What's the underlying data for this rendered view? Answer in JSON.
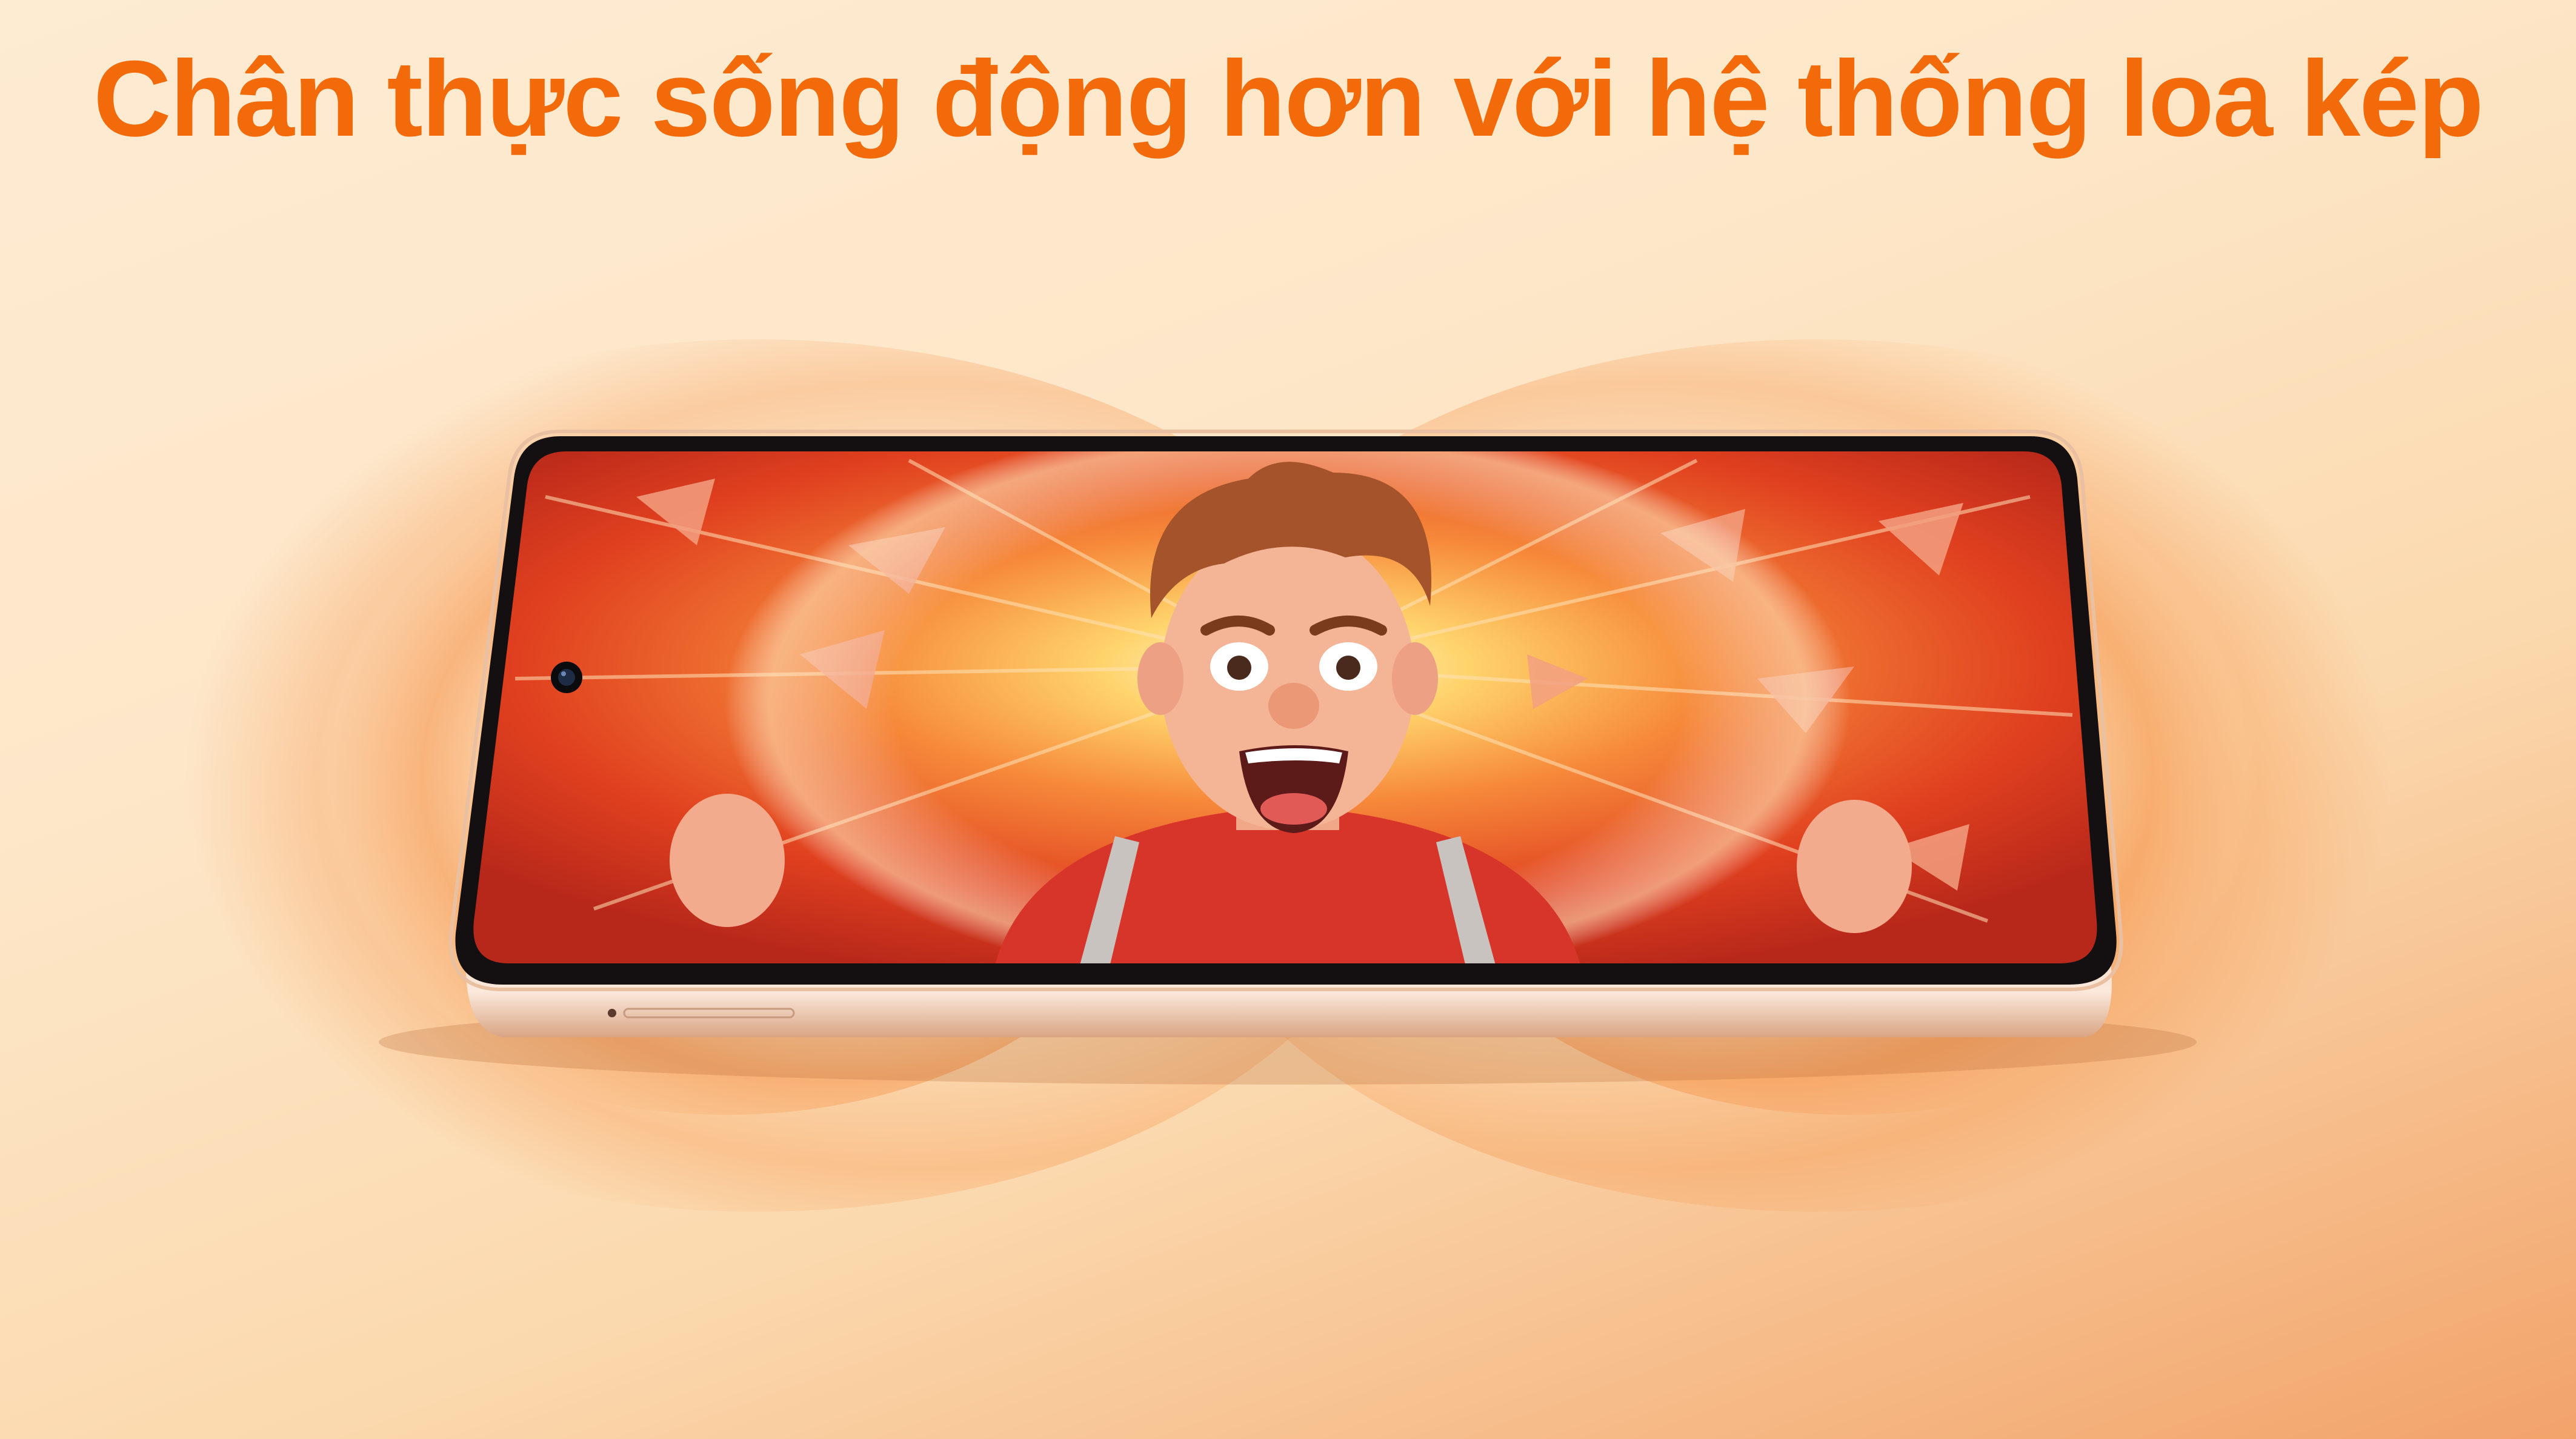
{
  "headline": {
    "text": "Chân thực sống động hơn với hệ thống loa kép"
  },
  "colors": {
    "headline": "#f26a0a",
    "wave_glow": "#f58a3c",
    "screen_hot": "#ffd36b",
    "screen_red": "#e0401f",
    "frame_gold": "#e9c1a2"
  },
  "icons": {
    "front_camera": "camera-lens-icon",
    "character": "surprised-cartoon-man-icon"
  }
}
